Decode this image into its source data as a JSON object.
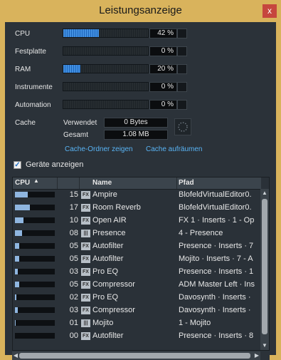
{
  "window": {
    "title": "Leistungsanzeige",
    "close_glyph": "x"
  },
  "meters": [
    {
      "label": "CPU",
      "value": "42 %",
      "fraction": 0.42
    },
    {
      "label": "Festplatte",
      "value": "0 %",
      "fraction": 0
    },
    {
      "label": "RAM",
      "value": "20 %",
      "fraction": 0.2
    },
    {
      "label": "Instrumente",
      "value": "0 %",
      "fraction": 0
    },
    {
      "label": "Automation",
      "value": "0 %",
      "fraction": 0
    }
  ],
  "cache": {
    "label": "Cache",
    "used_label": "Verwendet",
    "used_value": "0 Bytes",
    "total_label": "Gesamt",
    "total_value": "1.08 MB",
    "show_folder_link": "Cache-Ordner zeigen",
    "clean_link": "Cache aufräumen"
  },
  "show_devices": {
    "label": "Geräte anzeigen",
    "checked": true,
    "check_glyph": "✓"
  },
  "table": {
    "columns": [
      "CPU",
      "",
      "Name",
      "Pfad"
    ],
    "sort_glyph": "▲",
    "rows": [
      {
        "cpu": 0.15,
        "num": "15",
        "icon": "fx-icon",
        "icon_text": "FX",
        "name": "Ampire",
        "path": "BlofeldVirtualEditor0."
      },
      {
        "cpu": 0.17,
        "num": "17",
        "icon": "fx-icon",
        "icon_text": "FX",
        "name": "Room Reverb",
        "path": "BlofeldVirtualEditor0."
      },
      {
        "cpu": 0.1,
        "num": "10",
        "icon": "fx-icon",
        "icon_text": "FX",
        "name": "Open AIR",
        "path": "FX 1 · Inserts · 1 - Op"
      },
      {
        "cpu": 0.08,
        "num": "08",
        "icon": "instrument-icon",
        "icon_text": "|||",
        "name": "Presence",
        "path": "4 - Presence"
      },
      {
        "cpu": 0.05,
        "num": "05",
        "icon": "fx-icon",
        "icon_text": "FX",
        "name": "Autofilter",
        "path": "Presence · Inserts · 7"
      },
      {
        "cpu": 0.05,
        "num": "05",
        "icon": "fx-icon",
        "icon_text": "FX",
        "name": "Autofilter",
        "path": "Mojito · Inserts · 7 - A"
      },
      {
        "cpu": 0.03,
        "num": "03",
        "icon": "fx-icon",
        "icon_text": "FX",
        "name": "Pro EQ",
        "path": "Presence · Inserts · 1"
      },
      {
        "cpu": 0.05,
        "num": "05",
        "icon": "fx-icon",
        "icon_text": "FX",
        "name": "Compressor",
        "path": "ADM Master Left · Ins"
      },
      {
        "cpu": 0.02,
        "num": "02",
        "icon": "fx-icon",
        "icon_text": "FX",
        "name": "Pro EQ",
        "path": "Davosynth · Inserts ·"
      },
      {
        "cpu": 0.03,
        "num": "03",
        "icon": "fx-icon",
        "icon_text": "FX",
        "name": "Compressor",
        "path": "Davosynth · Inserts ·"
      },
      {
        "cpu": 0.01,
        "num": "01",
        "icon": "instrument-icon",
        "icon_text": "|||",
        "name": "Mojito",
        "path": "1 - Mojito"
      },
      {
        "cpu": 0.0,
        "num": "00",
        "icon": "fx-icon",
        "icon_text": "FX",
        "name": "Autofilter",
        "path": "Presence · Inserts · 8"
      }
    ]
  },
  "scrollbars": {
    "up": "▲",
    "down": "▼",
    "left": "◀",
    "right": "▶"
  },
  "colors": {
    "meter_fill": "#2d7fd9",
    "link": "#59b4f5",
    "title_bar": "#d9b35c",
    "close": "#c6463e"
  }
}
